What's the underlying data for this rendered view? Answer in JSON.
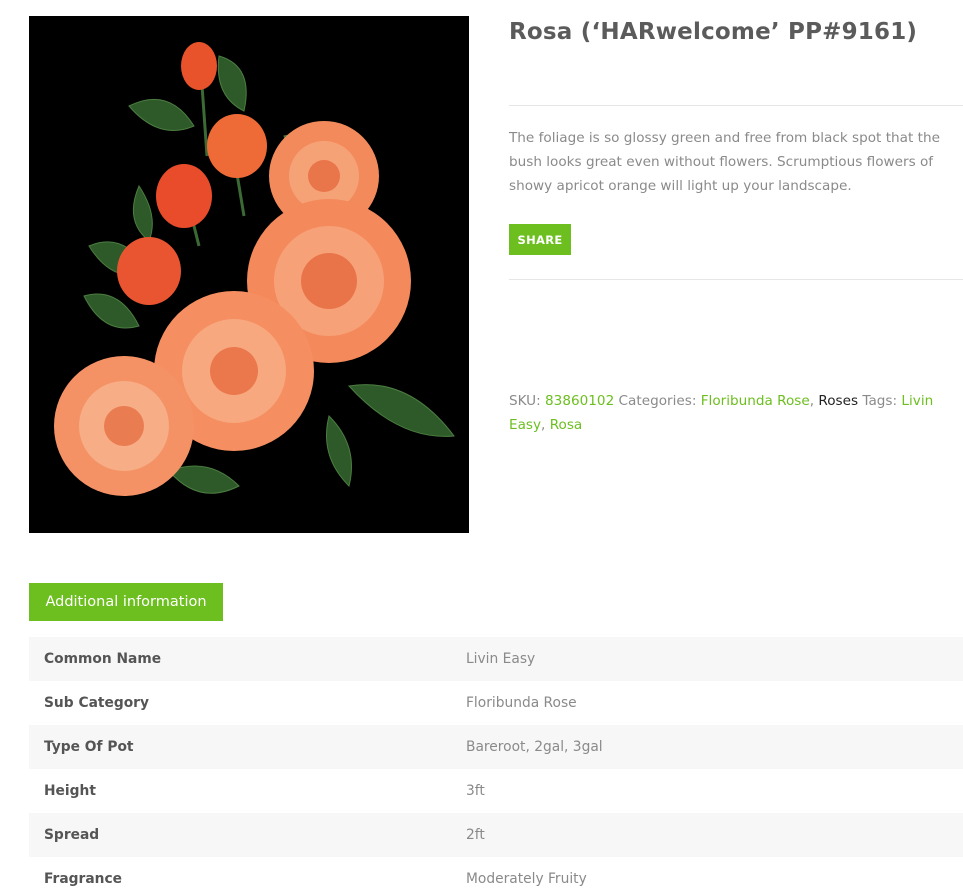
{
  "product": {
    "title": "Rosa (‘HARwelcome’ PP#9161)",
    "description": "The foliage is so glossy green and free from black spot that the bush looks great even without flowers. Scrumptious flowers of showy apricot orange will light up your landscape.",
    "share_label": "SHARE",
    "image_icon": "rose-bouquet-image"
  },
  "meta": {
    "sku_label": "SKU: ",
    "sku": "83860102",
    "categories_label": " Categories: ",
    "categories": [
      "Floribunda Rose",
      "Roses"
    ],
    "tags_label": " Tags: ",
    "tags": [
      "Livin Easy",
      "Rosa"
    ]
  },
  "tabs": {
    "additional_info": "Additional information"
  },
  "attributes": [
    {
      "label": "Common Name",
      "value": "Livin Easy"
    },
    {
      "label": "Sub Category",
      "value": "Floribunda Rose"
    },
    {
      "label": "Type Of Pot",
      "value": "Bareroot, 2gal, 3gal"
    },
    {
      "label": "Height",
      "value": "3ft"
    },
    {
      "label": "Spread",
      "value": "2ft"
    },
    {
      "label": "Fragrance",
      "value": "Moderately Fruity"
    }
  ],
  "colors": {
    "accent": "#6cbf1f",
    "heading": "#5b5b5b",
    "body_text": "#8a8a8a"
  }
}
